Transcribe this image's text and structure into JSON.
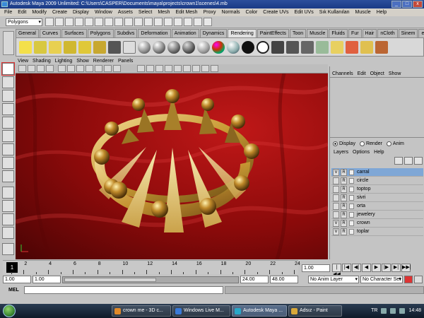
{
  "window": {
    "title": "Autodesk Maya 2009 Unlimited: C:\\Users\\CASPER\\Documents\\maya\\projects\\crown1\\scenes\\4.mb",
    "minimize": "_",
    "maximize": "□",
    "close": "x"
  },
  "menubar": {
    "items": [
      "File",
      "Edit",
      "Modify",
      "Create",
      "Display",
      "Window",
      "Assets",
      "Select",
      "Mesh",
      "Edit Mesh",
      "Proxy",
      "Normals",
      "Color",
      "Create UVs",
      "Edit UVs",
      "Sık Kullanılan",
      "Muscle",
      "Help"
    ]
  },
  "statusline": {
    "mode": "Polygons"
  },
  "shelf": {
    "tabs": [
      "General",
      "Curves",
      "Surfaces",
      "Polygons",
      "Subdivs",
      "Deformation",
      "Animation",
      "Dynamics",
      "Rendering",
      "PaintEffects",
      "Toon",
      "Muscle",
      "Fluids",
      "Fur",
      "Hair",
      "nCloth",
      "Sinem",
      "ersin"
    ],
    "active_tab": "Rendering"
  },
  "viewport": {
    "menu": [
      "View",
      "Shading",
      "Lighting",
      "Show",
      "Renderer",
      "Panels"
    ]
  },
  "channelbox": {
    "menu": [
      "Channels",
      "Edit",
      "Object",
      "Show"
    ]
  },
  "layereditor": {
    "modes": [
      "Display",
      "Render",
      "Anim"
    ],
    "selected_mode": "Display",
    "menu": [
      "Layers",
      "Options",
      "Help"
    ],
    "layers": [
      {
        "v": "V",
        "r": "R",
        "name": "carral",
        "selected": true
      },
      {
        "v": "",
        "r": "R",
        "name": "circle",
        "selected": false
      },
      {
        "v": "",
        "r": "R",
        "name": "toptop",
        "selected": false
      },
      {
        "v": "",
        "r": "R",
        "name": "sivri",
        "selected": false
      },
      {
        "v": "",
        "r": "R",
        "name": "orta",
        "selected": false
      },
      {
        "v": "",
        "r": "R",
        "name": "jewelery",
        "selected": false
      },
      {
        "v": "V",
        "r": "R",
        "name": "crown",
        "selected": false
      },
      {
        "v": "V",
        "r": "R",
        "name": "toplar",
        "selected": false
      }
    ]
  },
  "timeslider": {
    "current_frame": "1",
    "tick_labels": [
      "2",
      "4",
      "6",
      "8",
      "10",
      "12",
      "14",
      "16",
      "18",
      "20",
      "22",
      "24"
    ],
    "current_time_field": "1.00",
    "playback": [
      "|◀◀",
      "|◀",
      "◀|",
      "◀",
      "▶",
      "|▶",
      "▶|",
      "▶▶|"
    ]
  },
  "rangeslider": {
    "start": "1.00",
    "playback_start": "1.00",
    "playback_end": "24.00",
    "end": "48.00",
    "anim_layer": "No Anim Layer",
    "character_set": "No Character Set"
  },
  "commandline": {
    "label": "MEL"
  },
  "taskbar": {
    "buttons": [
      {
        "label": "crown me - 3D c...",
        "color": "#e08a2a",
        "active": false
      },
      {
        "label": "Windows Live M...",
        "color": "#3a7ad8",
        "active": false
      },
      {
        "label": "Autodesk Maya ...",
        "color": "#2aa8c8",
        "active": true
      },
      {
        "label": "Adsız - Paint",
        "color": "#d8a83a",
        "active": false
      }
    ],
    "lang": "TR",
    "time": "14:48"
  },
  "colors": {
    "viewport_cloth": "#a81010",
    "crown_gold": "#c89a34",
    "layer_selected": "#7fa7d6"
  }
}
